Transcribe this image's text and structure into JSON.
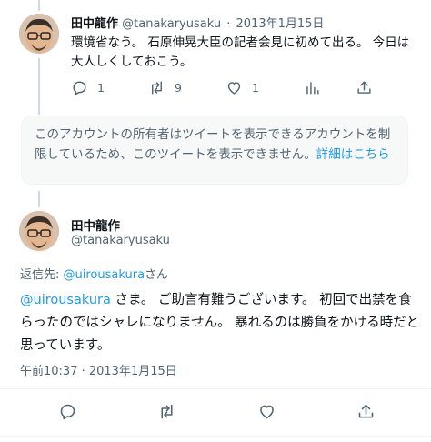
{
  "tweet1": {
    "display_name": "田中龍作",
    "handle": "@tanakaryusaku",
    "separator": "·",
    "date": "2013年1月15日",
    "text": "環境省なう。 石原伸晃大臣の記者会見に初めて出る。 今日は大人しくしておこう。",
    "counts": {
      "replies": "1",
      "retweets": "9",
      "likes": "1"
    }
  },
  "restricted_notice": {
    "text": "このアカウントの所有者はツイートを表示できるアカウントを制限しているため、このツイートを表示できません。",
    "link_label": "詳細はこちら"
  },
  "main_tweet": {
    "display_name": "田中龍作",
    "handle": "@tanakaryusaku",
    "reply_prefix": "返信先: ",
    "reply_to": "@uirousakura",
    "reply_suffix": "さん",
    "mention": "@uirousakura",
    "text": " さま。 ご助言有難うございます。 初回で出禁を食らったのではシャレになりません。 暴れるのは勝負をかける時だと思っています。",
    "timestamp": "午前10:37 · 2013年1月15日"
  },
  "icons": {
    "reply": "reply-icon",
    "retweet": "retweet-icon",
    "like": "like-icon",
    "views": "views-icon",
    "share": "share-icon"
  },
  "colors": {
    "link": "#1d9bf0",
    "secondary_text": "#536471",
    "primary_text": "#0f1419",
    "notice_bg": "#f7f9f9"
  }
}
